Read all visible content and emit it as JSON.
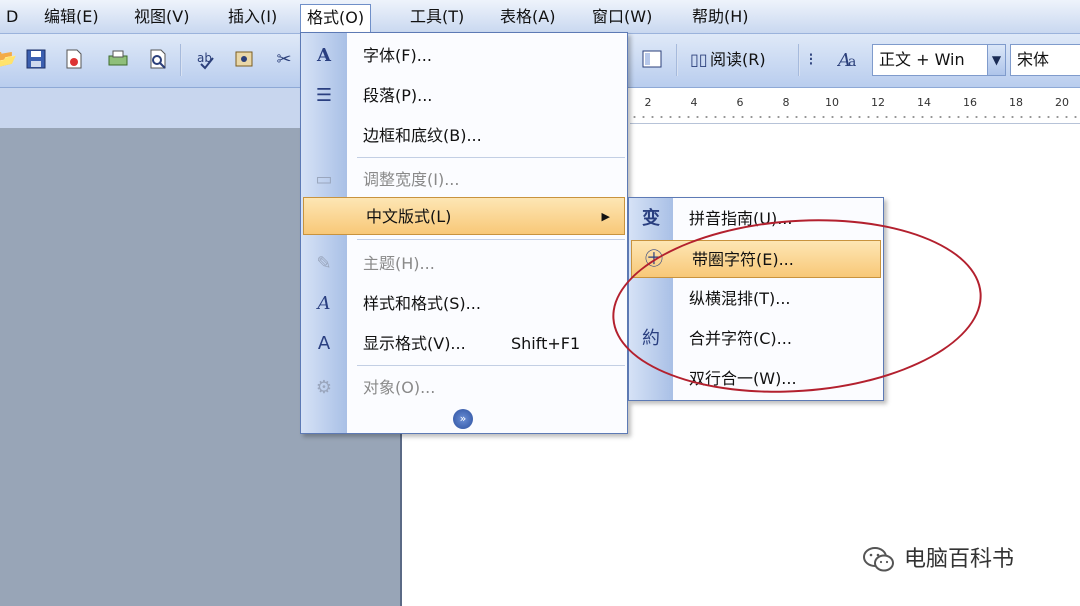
{
  "menubar": {
    "items": [
      {
        "label": "D",
        "open": false
      },
      {
        "label": "编辑(E)",
        "open": false
      },
      {
        "label": "视图(V)",
        "open": false
      },
      {
        "label": "插入(I)",
        "open": false
      },
      {
        "label": "格式(O)",
        "open": true
      },
      {
        "label": "工具(T)",
        "open": false
      },
      {
        "label": "表格(A)",
        "open": false
      },
      {
        "label": "窗口(W)",
        "open": false
      },
      {
        "label": "帮助(H)",
        "open": false
      }
    ]
  },
  "toolbar": {
    "icons": [
      "open-folder-icon",
      "save-icon",
      "permission-icon",
      "print-icon",
      "print-preview-icon",
      "spelling-icon",
      "research-icon"
    ],
    "reading_label": "阅读(R)",
    "style_combo": "正文 + Win",
    "font_combo": "宋体"
  },
  "ruler": {
    "ticks": [
      "2",
      "4",
      "6",
      "8",
      "10",
      "12",
      "14",
      "16",
      "18",
      "20"
    ]
  },
  "format_menu": {
    "items": [
      {
        "label": "字体(F)...",
        "icon": "font-icon",
        "disabled": false
      },
      {
        "label": "段落(P)...",
        "icon": "paragraph-icon",
        "disabled": false
      },
      {
        "label": "边框和底纹(B)...",
        "icon": "",
        "disabled": false
      },
      {
        "label": "调整宽度(I)...",
        "icon": "fit-width-icon",
        "disabled": true
      },
      {
        "label": "中文版式(L)",
        "icon": "",
        "disabled": false,
        "highlighted": true,
        "has_submenu": true
      },
      {
        "label": "主题(H)...",
        "icon": "theme-icon",
        "disabled": true
      },
      {
        "label": "样式和格式(S)...",
        "icon": "styles-icon",
        "disabled": false
      },
      {
        "label": "显示格式(V)...",
        "icon": "reveal-format-icon",
        "disabled": false,
        "shortcut": "Shift+F1"
      },
      {
        "label": "对象(O)...",
        "icon": "object-icon",
        "disabled": true
      }
    ],
    "expand_icon": "double-chevron-down-icon"
  },
  "submenu": {
    "items": [
      {
        "label": "拼音指南(U)...",
        "icon": "phonetic-guide-icon",
        "highlighted": false
      },
      {
        "label": "带圈字符(E)...",
        "icon": "enclosed-char-icon",
        "highlighted": true
      },
      {
        "label": "纵横混排(T)...",
        "icon": "",
        "highlighted": false
      },
      {
        "label": "合并字符(C)...",
        "icon": "combine-chars-icon",
        "highlighted": false
      },
      {
        "label": "双行合一(W)...",
        "icon": "",
        "highlighted": false
      }
    ]
  },
  "watermark": {
    "text": "电脑百科书"
  },
  "colors": {
    "highlight": "#f8c878",
    "menu_gutter": "#a9c0e6",
    "annotation": "#b3202e"
  }
}
